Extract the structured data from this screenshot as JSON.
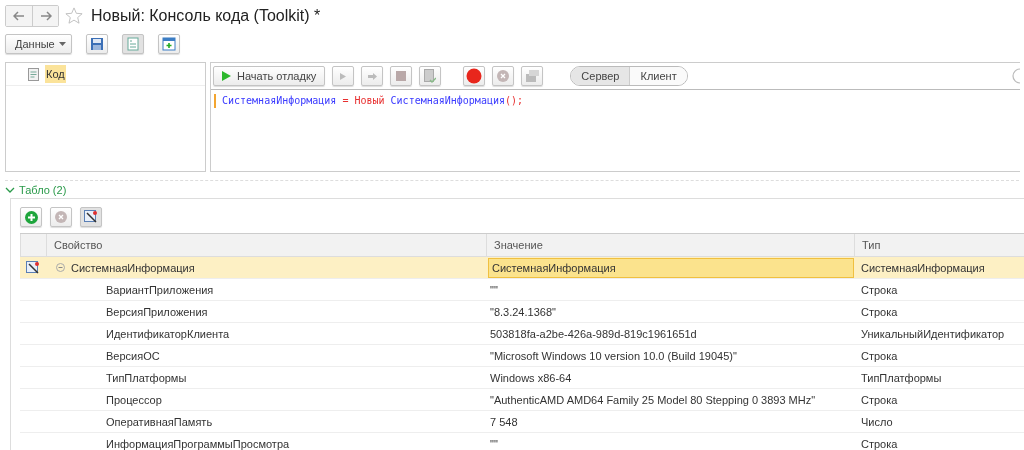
{
  "window": {
    "title": "Новый: Консоль кода (Toolkit) *",
    "favorite": false
  },
  "toolbar": {
    "menu": "Данные"
  },
  "tree": {
    "items": [
      {
        "label": "Код",
        "selected": true
      }
    ]
  },
  "debug": {
    "start": "Начать отладку",
    "modes": [
      {
        "label": "Сервер",
        "selected": true
      },
      {
        "label": "Клиент",
        "selected": false
      }
    ]
  },
  "code": {
    "tokens": [
      {
        "kind": "ident",
        "text": "СистемнаяИнформация"
      },
      {
        "kind": "op",
        "text": " = "
      },
      {
        "kind": "keyword",
        "text": "Новый"
      },
      {
        "kind": "ident",
        "text": " СистемнаяИнформация"
      },
      {
        "kind": "op",
        "text": "();"
      }
    ]
  },
  "section": {
    "title": "Табло (2)",
    "expanded": true
  },
  "table": {
    "columns": [
      "Свойство",
      "Значение",
      "Тип"
    ],
    "rows": [
      {
        "name": "СистемнаяИнформация",
        "value": "СистемнаяИнформация",
        "type": "СистемнаяИнформация",
        "selected": true,
        "expanded": true,
        "children": [
          {
            "name": "ВариантПриложения",
            "value": "\"\"",
            "type": "Строка",
            "selected": false
          },
          {
            "name": "ВерсияПриложения",
            "value": "\"8.3.24.1368\"",
            "type": "Строка",
            "selected": false
          },
          {
            "name": "ИдентификаторКлиента",
            "value": "503818fa-a2be-426a-989d-819c1961651d",
            "type": "УникальныйИдентификатор",
            "selected": false
          },
          {
            "name": "ВерсияОС",
            "value": "\"Microsoft Windows 10 version 10.0  (Build 19045)\"",
            "type": "Строка",
            "selected": false
          },
          {
            "name": "ТипПлатформы",
            "value": "Windows x86-64",
            "type": "ТипПлатформы",
            "selected": false
          },
          {
            "name": "Процессор",
            "value": "\"AuthenticAMD AMD64 Family 25 Model 80 Stepping 0 3893 MHz\"",
            "type": "Строка",
            "selected": false
          },
          {
            "name": "ОперативнаяПамять",
            "value": "7 548",
            "type": "Число",
            "selected": false
          },
          {
            "name": "ИнформацияПрограммыПросмотра",
            "value": "\"\"",
            "type": "Строка",
            "selected": false
          }
        ]
      }
    ]
  }
}
